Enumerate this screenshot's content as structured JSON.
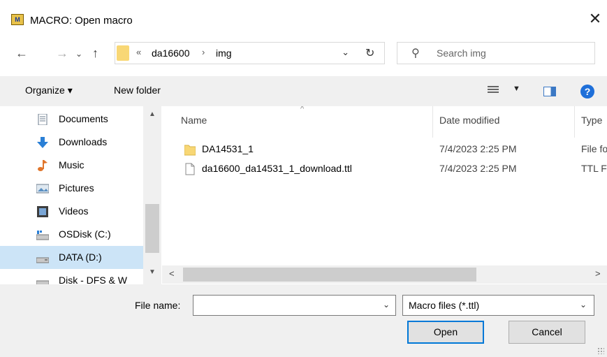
{
  "window": {
    "title": "MACRO: Open macro",
    "app_icon_letter": "M",
    "close_glyph": "✕"
  },
  "address": {
    "overflow": "«",
    "parts": [
      "da16600",
      "img"
    ],
    "separator": "›",
    "dropdown_glyph": "⌄",
    "refresh_glyph": "↻",
    "back_glyph": "←",
    "forward_glyph": "→",
    "recent_glyph": "⌄",
    "up_glyph": "↑"
  },
  "search": {
    "placeholder": "Search img",
    "icon_glyph": "⚲"
  },
  "toolbar": {
    "organize_label": "Organize ▾",
    "new_folder_label": "New folder",
    "view_dropdown_glyph": "▼",
    "help_glyph": "?"
  },
  "sidebar": {
    "items": [
      {
        "label": "Documents",
        "icon": "documents-icon",
        "selected": false
      },
      {
        "label": "Downloads",
        "icon": "downloads-icon",
        "selected": false
      },
      {
        "label": "Music",
        "icon": "music-icon",
        "selected": false
      },
      {
        "label": "Pictures",
        "icon": "pictures-icon",
        "selected": false
      },
      {
        "label": "Videos",
        "icon": "videos-icon",
        "selected": false
      },
      {
        "label": "OSDisk (C:)",
        "icon": "drive-icon",
        "selected": false
      },
      {
        "label": "DATA (D:)",
        "icon": "drive-icon",
        "selected": true
      },
      {
        "label": "Disk - DFS & W",
        "icon": "network-drive-icon",
        "selected": false
      }
    ],
    "scroll_up_glyph": "▲",
    "scroll_down_glyph": "▼"
  },
  "file_list": {
    "columns": {
      "name": "Name",
      "date": "Date modified",
      "type": "Type"
    },
    "sort_glyph": "^",
    "rows": [
      {
        "name": "DA14531_1",
        "date": "7/4/2023 2:25 PM",
        "type": "File folder",
        "kind": "folder"
      },
      {
        "name": "da16600_da14531_1_download.ttl",
        "date": "7/4/2023 2:25 PM",
        "type": "TTL File",
        "kind": "file"
      }
    ],
    "scroll_left_glyph": "<",
    "scroll_right_glyph": ">"
  },
  "footer": {
    "file_name_label": "File name:",
    "file_name_value": "",
    "file_name_drop": "⌄",
    "filter_value": "Macro files (*.ttl)",
    "filter_drop": "⌄",
    "open_label": "Open",
    "cancel_label": "Cancel"
  },
  "colors": {
    "selection": "#cce4f7",
    "folder": "#f8d775",
    "accent": "#0078d7"
  }
}
